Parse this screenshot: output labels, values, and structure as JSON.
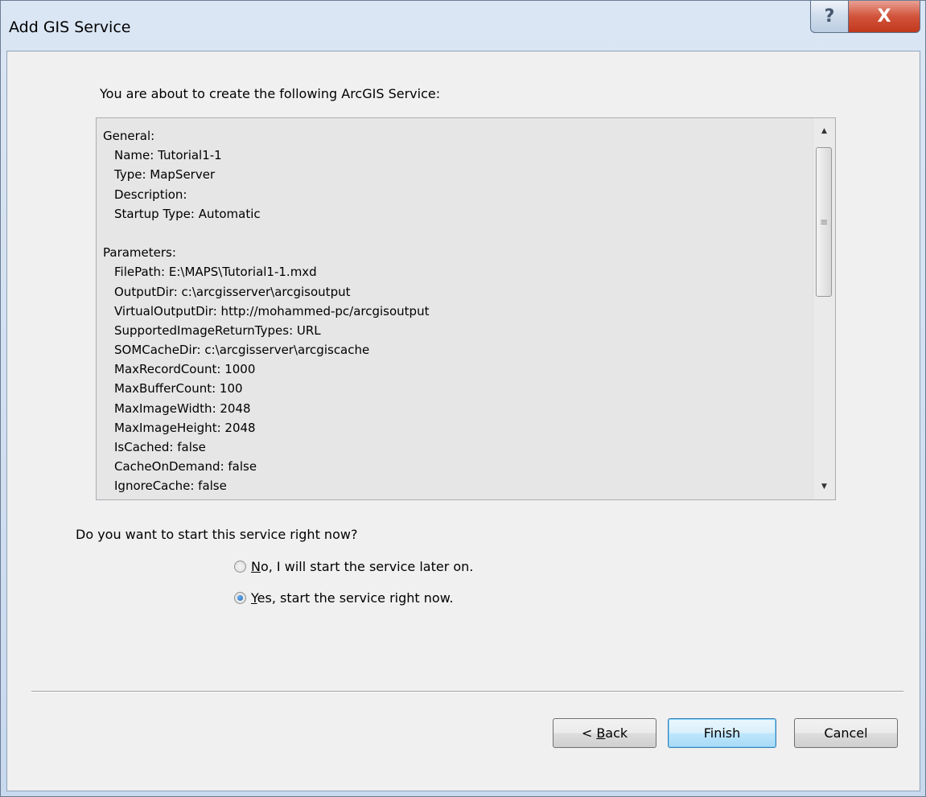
{
  "window": {
    "title": "Add GIS Service",
    "help_symbol": "?",
    "close_symbol": "X"
  },
  "intro_text": "You are about to create the following ArcGIS Service:",
  "summary": {
    "general_header": "General:",
    "general": [
      "Name: Tutorial1-1",
      "Type: MapServer",
      "Description:",
      "Startup Type: Automatic"
    ],
    "parameters_header": "Parameters:",
    "parameters": [
      "FilePath: E:\\MAPS\\Tutorial1-1.mxd",
      "OutputDir: c:\\arcgisserver\\arcgisoutput",
      "VirtualOutputDir: http://mohammed-pc/arcgisoutput",
      "SupportedImageReturnTypes: URL",
      "SOMCacheDir: c:\\arcgisserver\\arcgiscache",
      "MaxRecordCount: 1000",
      "MaxBufferCount: 100",
      "MaxImageWidth: 2048",
      "MaxImageHeight: 2048",
      "IsCached: false",
      "CacheOnDemand: false",
      "IgnoreCache: false"
    ],
    "scroll_up_icon": "▲",
    "scroll_down_icon": "▼",
    "scroll_grip": "≡"
  },
  "start_question": "Do you want to start this service right now?",
  "options": [
    {
      "mnemonic": "N",
      "rest": "o, I will start the service later on.",
      "checked": false
    },
    {
      "mnemonic": "Y",
      "rest": "es, start the service right now.",
      "checked": true
    }
  ],
  "buttons": {
    "back_prefix": "< ",
    "back_mnemonic": "B",
    "back_rest": "ack",
    "finish": "Finish",
    "cancel": "Cancel"
  }
}
